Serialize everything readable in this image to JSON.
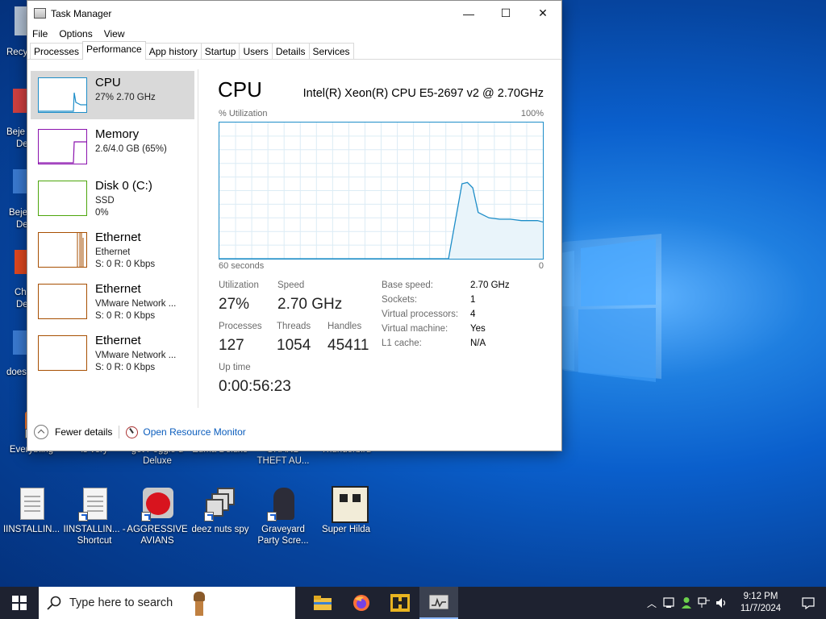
{
  "desktop": {
    "icons_row1": [
      {
        "label": "Everything"
      },
      {
        "label": "is very"
      },
      {
        "label": "get Peggle d Deluxe"
      },
      {
        "label": "Zuma Deluxe"
      },
      {
        "label": "GRAND THEFT AU..."
      },
      {
        "label": "Thunderbird"
      }
    ],
    "icons_row2": [
      {
        "label": "IINSTALLIN..."
      },
      {
        "label": "IINSTALLIN... - Shortcut"
      },
      {
        "label": "AGGRESSIVE AVIANS"
      },
      {
        "label": "deez nuts spy"
      },
      {
        "label": "Graveyard Party Scre..."
      },
      {
        "label": "Super Hilda"
      }
    ],
    "left_peek": [
      "Recy",
      "Beje",
      "De",
      "Beje",
      "De",
      "Ch",
      "De",
      "does"
    ]
  },
  "window": {
    "title": "Task Manager",
    "controls": {
      "minimize": "—",
      "maximize": "☐",
      "close": "✕"
    },
    "menu": [
      "File",
      "Options",
      "View"
    ],
    "tabs": [
      "Processes",
      "Performance",
      "App history",
      "Startup",
      "Users",
      "Details",
      "Services"
    ],
    "active_tab": "Performance"
  },
  "sidebar": [
    {
      "name": "CPU",
      "sub1": "27% 2.70 GHz",
      "sub2": "",
      "sub3": "",
      "color": "#1d8dc8"
    },
    {
      "name": "Memory",
      "sub1": "2.6/4.0 GB (65%)",
      "sub2": "",
      "sub3": "",
      "color": "#8b12ae"
    },
    {
      "name": "Disk 0 (C:)",
      "sub1": "SSD",
      "sub2": "0%",
      "sub3": "",
      "color": "#4da60c"
    },
    {
      "name": "Ethernet",
      "sub1": "Ethernet",
      "sub2": "S: 0 R: 0 Kbps",
      "sub3": "",
      "color": "#a74f01"
    },
    {
      "name": "Ethernet",
      "sub1": "VMware Network ...",
      "sub2": "S: 0 R: 0 Kbps",
      "sub3": "",
      "color": "#a74f01"
    },
    {
      "name": "Ethernet",
      "sub1": "VMware Network ...",
      "sub2": "S: 0 R: 0 Kbps",
      "sub3": "",
      "color": "#a74f01"
    }
  ],
  "cpu": {
    "heading": "CPU",
    "model": "Intel(R) Xeon(R) CPU E5-2697 v2 @ 2.70GHz",
    "graph_label_left": "% Utilization",
    "graph_label_right": "100%",
    "graph_time_left": "60 seconds",
    "graph_time_right": "0",
    "chart_data": {
      "type": "area",
      "x_seconds_ago": [
        60,
        50,
        40,
        30,
        17.5,
        15,
        14,
        13,
        12,
        11,
        10,
        8,
        6,
        4,
        2,
        1,
        0
      ],
      "utilization": [
        0,
        0,
        0,
        0,
        0,
        55,
        56,
        52,
        34,
        32,
        30,
        29,
        29,
        28,
        28,
        28,
        27
      ],
      "ylim": [
        0,
        100
      ],
      "xlim": [
        60,
        0
      ]
    },
    "stats": {
      "utilization_label": "Utilization",
      "utilization": "27%",
      "speed_label": "Speed",
      "speed": "2.70 GHz",
      "processes_label": "Processes",
      "processes": "127",
      "threads_label": "Threads",
      "threads": "1054",
      "handles_label": "Handles",
      "handles": "45411",
      "uptime_label": "Up time",
      "uptime": "0:00:56:23"
    },
    "details": [
      {
        "k": "Base speed:",
        "v": "2.70 GHz"
      },
      {
        "k": "Sockets:",
        "v": "1"
      },
      {
        "k": "Virtual processors:",
        "v": "4"
      },
      {
        "k": "Virtual machine:",
        "v": "Yes"
      },
      {
        "k": "L1 cache:",
        "v": "N/A"
      }
    ]
  },
  "footer": {
    "fewer_details": "Fewer details",
    "resource_monitor": "Open Resource Monitor"
  },
  "taskbar": {
    "search_placeholder": "Type here to search",
    "time": "9:12 PM",
    "date": "11/7/2024"
  }
}
